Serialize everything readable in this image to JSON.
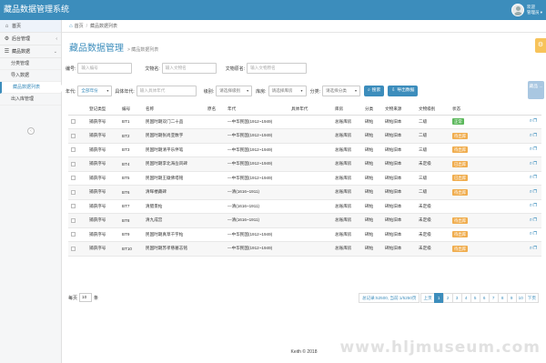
{
  "header": {
    "app_title": "藏品数据管理系统",
    "user_line1": "欢迎",
    "user_line2": "管理员 ▾"
  },
  "sidebar": {
    "home": "首页",
    "groups": [
      {
        "label": "后台管理"
      },
      {
        "label": "藏品数据",
        "children": [
          "分类管理",
          "导入数据",
          "藏品数据列表",
          "出入库管理"
        ]
      }
    ]
  },
  "breadcrumb": {
    "root": "首页",
    "current": "藏品数据列表"
  },
  "page": {
    "title": "藏品数据管理",
    "subtitle": "> 藏品数据列表",
    "float_btn": "藏品 ..."
  },
  "filters": {
    "row1": [
      {
        "label": "编号:",
        "placeholder": "输入编号"
      },
      {
        "label": "文物名:",
        "placeholder": "输入文物名"
      },
      {
        "label": "文物原名:",
        "placeholder": "输入文物原名"
      }
    ],
    "row2": {
      "era_label": "年代:",
      "era_value": "全部年份",
      "era_detail_label": "具体年代:",
      "era_detail_placeholder": "输入具体年代",
      "level_label": "级别:",
      "level_value": "请选择级别",
      "store_label": "库房:",
      "store_value": "请选择库房",
      "cat_label": "分类:",
      "cat_value": "请选择分类",
      "search_btn": "搜索",
      "export_btn": "导出数据"
    }
  },
  "table": {
    "columns": [
      "",
      "登记类型",
      "编号",
      "名称",
      "原名",
      "年代",
      "具体年代",
      "库房",
      "分类",
      "文物来源",
      "文物级别",
      "状态",
      ""
    ],
    "rows": [
      {
        "type": "捕获序号",
        "no": "BT1",
        "name": "民国时期双门二十品",
        "era": "—中华民国(1912~1949)",
        "store": "总账库房",
        "cat": "碑帖",
        "src": "碑帖旧本",
        "level": "二级",
        "status": "正常",
        "status_color": "#5cb85c"
      },
      {
        "type": "捕获序号",
        "no": "BT2",
        "name": "民国时期张尚亚数字",
        "era": "—中华民国(1912~1949)",
        "store": "总账库房",
        "cat": "碑帖",
        "src": "碑帖旧本",
        "level": "二级",
        "status": "待出库",
        "status_color": "#f0ad4e"
      },
      {
        "type": "捕获序号",
        "no": "BT3",
        "name": "民国时期清平乐伴笔",
        "era": "—中华民国(1912~1949)",
        "store": "总账库房",
        "cat": "碑帖",
        "src": "碑帖旧本",
        "level": "三级",
        "status": "待出库",
        "status_color": "#f0ad4e"
      },
      {
        "type": "捕获序号",
        "no": "BT4",
        "name": "民国时期李北海岳风碑",
        "era": "—中华民国(1912~1949)",
        "store": "总账库房",
        "cat": "碑帖",
        "src": "碑帖旧本",
        "level": "未定级",
        "status": "已出库",
        "status_color": "#f0ad4e"
      },
      {
        "type": "捕获序号",
        "no": "BT5",
        "name": "民国时期王徽佛塔铭",
        "era": "—中华民国(1912~1949)",
        "store": "总账库房",
        "cat": "碑帖",
        "src": "碑帖旧本",
        "level": "三级",
        "status": "已出库",
        "status_color": "#f0ad4e"
      },
      {
        "type": "捕获序号",
        "no": "BT6",
        "name": "清晖楼藏碑",
        "era": "—清(1616~1911)",
        "store": "总账库房",
        "cat": "碑帖",
        "src": "碑帖旧本",
        "level": "二级",
        "status": "待出库",
        "status_color": "#f0ad4e"
      },
      {
        "type": "捕获序号",
        "no": "BT7",
        "name": "清腊景帖",
        "era": "—清(1616~1911)",
        "store": "总账库房",
        "cat": "碑帖",
        "src": "碑帖旧本",
        "level": "未定级",
        "status": "",
        "status_color": ""
      },
      {
        "type": "捕获序号",
        "no": "BT8",
        "name": "清九成宫",
        "era": "—清(1616~1911)",
        "store": "总账库房",
        "cat": "碑帖",
        "src": "碑帖旧本",
        "level": "未定级",
        "status": "待出库",
        "status_color": "#f0ad4e"
      },
      {
        "type": "捕获序号",
        "no": "BT9",
        "name": "民国时期真草千字帖",
        "era": "—中华民国(1912~1949)",
        "store": "总账库房",
        "cat": "碑帖",
        "src": "碑帖旧本",
        "level": "未定级",
        "status": "待出库",
        "status_color": "#f0ad4e"
      },
      {
        "type": "捕获序号",
        "no": "BT10",
        "name": "民国时期苏孝慈墓志铭",
        "era": "—中华民国(1912~1949)",
        "store": "总账库房",
        "cat": "碑帖",
        "src": "碑帖旧本",
        "level": "未定级",
        "status": "待出库",
        "status_color": "#f0ad4e"
      }
    ]
  },
  "pagination": {
    "per_page_label": "每页",
    "per_page_value": "10",
    "per_page_unit": "条",
    "total": "总记录:52500, 当前:1/5250页",
    "prev": "上页",
    "pages": [
      "1",
      "2",
      "3",
      "4",
      "5",
      "6",
      "7",
      "8",
      "9",
      "10"
    ],
    "next": "下页",
    "current": "1"
  },
  "footer": "Keith © 2018",
  "watermark": "www.hljmuseum.com"
}
